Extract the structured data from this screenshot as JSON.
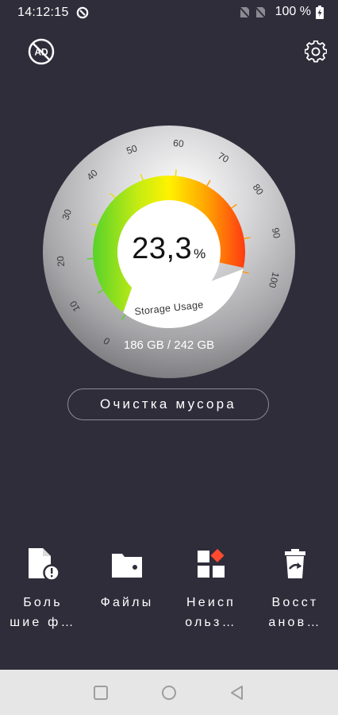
{
  "status_bar": {
    "time": "14:12:15",
    "battery": "100 %"
  },
  "gauge": {
    "scale_labels": [
      "0",
      "10",
      "20",
      "30",
      "40",
      "50",
      "60",
      "70",
      "80",
      "90",
      "100"
    ],
    "percent_value": "23,3",
    "percent_unit": "%",
    "usage_fraction": 0.233,
    "label": "Storage Usage",
    "capacity": "186 GB / 242 GB",
    "colors": {
      "green": "#5bd52b",
      "yellow": "#ffef00",
      "orange": "#ff9500",
      "red": "#ff3b14"
    }
  },
  "clean_button": {
    "label": "Очистка мусора"
  },
  "tools": [
    {
      "label": "Боль\nшие ф…",
      "icon": "large-file-warning-icon"
    },
    {
      "label": "Файлы",
      "icon": "folder-icon"
    },
    {
      "label": "Неисп\nольз…",
      "icon": "unused-apps-icon"
    },
    {
      "label": "Восст\nанов…",
      "icon": "restore-trash-icon"
    }
  ],
  "nav": {
    "buttons": [
      "recents-square-icon",
      "home-circle-icon",
      "back-triangle-icon"
    ]
  }
}
